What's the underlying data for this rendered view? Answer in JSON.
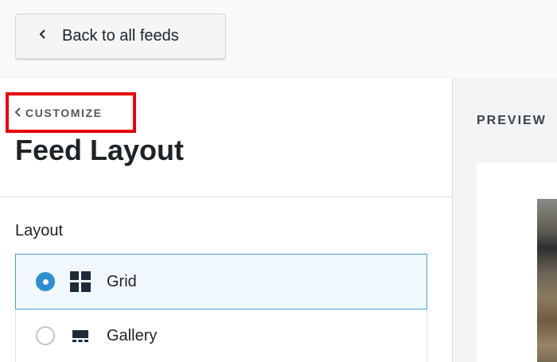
{
  "topbar": {
    "back_label": "Back to all feeds"
  },
  "sidebar": {
    "breadcrumb": "CUSTOMIZE",
    "title": "Feed Layout",
    "section_label": "Layout",
    "options": [
      {
        "label": "Grid",
        "selected": true,
        "icon": "grid-icon"
      },
      {
        "label": "Gallery",
        "selected": false,
        "icon": "gallery-icon"
      }
    ]
  },
  "preview": {
    "label": "PREVIEW"
  },
  "colors": {
    "accent": "#2e8fd0",
    "highlight": "#e8000b",
    "selected_bg": "#f0f8fd"
  }
}
